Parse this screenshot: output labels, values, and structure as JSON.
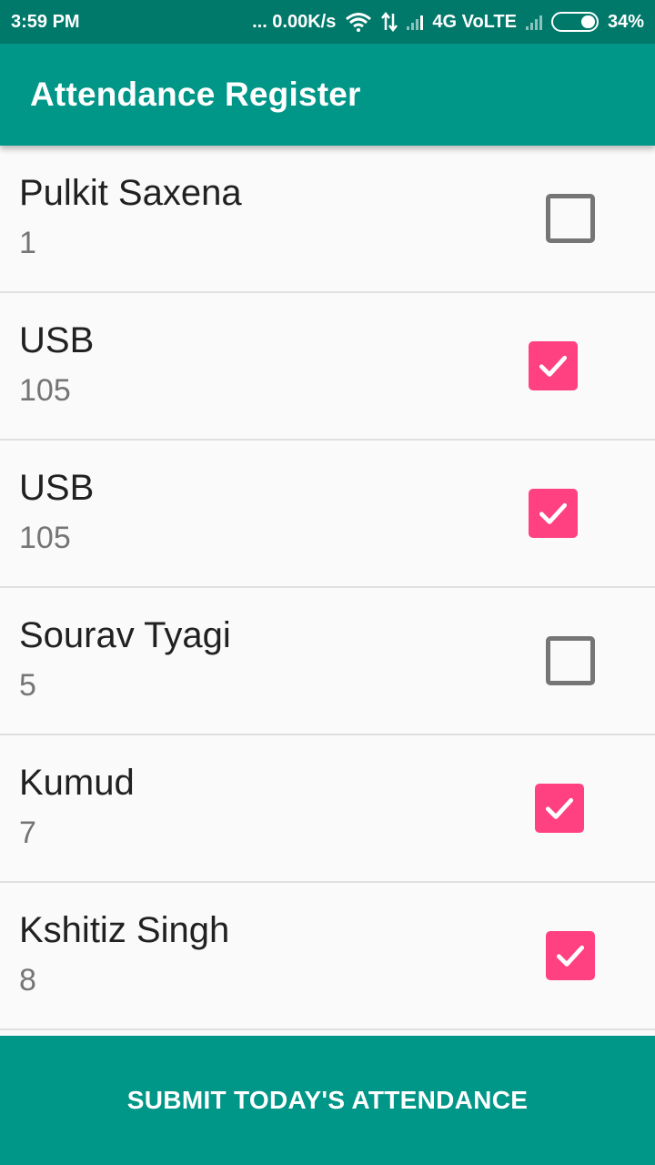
{
  "status_bar": {
    "time": "3:59 PM",
    "network_speed": "... 0.00K/s",
    "network_type": "4G VoLTE",
    "battery": "34%",
    "icons": [
      "wifi-icon",
      "data-arrows-icon",
      "signal-icon",
      "signal-no-sim-icon",
      "battery-icon"
    ]
  },
  "app_bar": {
    "title": "Attendance Register"
  },
  "students": [
    {
      "name": "Pulkit Saxena",
      "roll": "1",
      "present": false
    },
    {
      "name": "USB",
      "roll": "105",
      "present": true
    },
    {
      "name": "USB",
      "roll": "105",
      "present": true
    },
    {
      "name": "Sourav Tyagi",
      "roll": "5",
      "present": false
    },
    {
      "name": "Kumud",
      "roll": "7",
      "present": true
    },
    {
      "name": "Kshitiz Singh",
      "roll": "8",
      "present": true
    }
  ],
  "submit_button": {
    "label": "SUBMIT TODAY'S ATTENDANCE"
  },
  "colors": {
    "primary": "#009688",
    "primary_dark": "#00796b",
    "accent": "#ff4081"
  }
}
